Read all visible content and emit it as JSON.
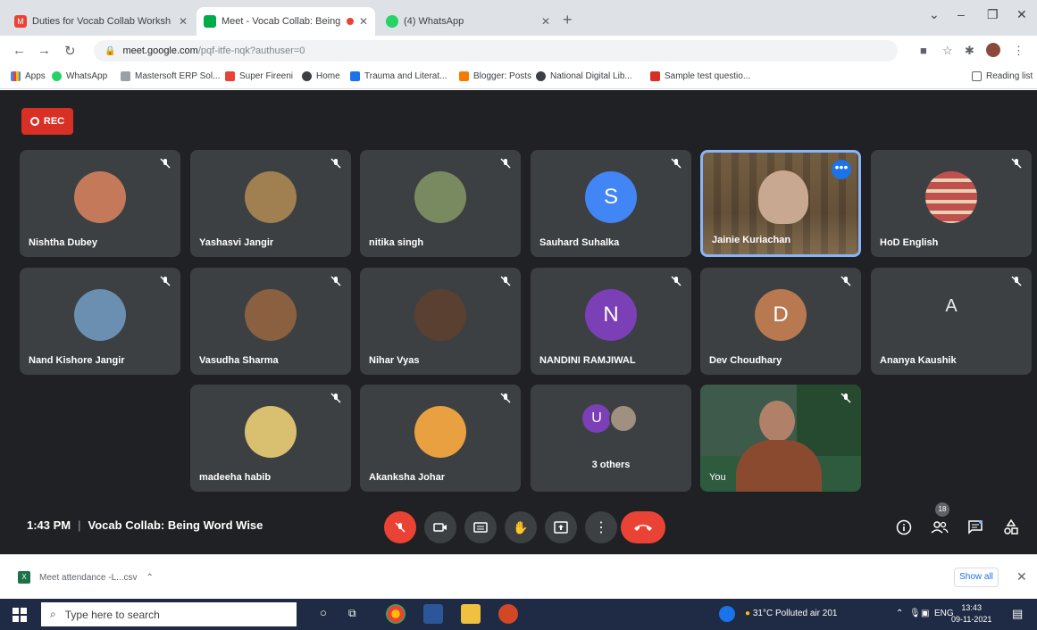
{
  "browser": {
    "tabs": [
      {
        "title": "Duties for Vocab Collab Worksh",
        "fav_color": "#ea4335",
        "active": false
      },
      {
        "title": "Meet - Vocab Collab: Being",
        "fav_color": "#00ac47",
        "active": true
      },
      {
        "title": "(4) WhatsApp",
        "fav_color": "#25d366",
        "active": false
      }
    ],
    "url_host": "meet.google.com",
    "url_path": "/pqf-itfe-nqk?authuser=0",
    "bookmarks": [
      "Apps",
      "WhatsApp",
      "Mastersoft ERP Sol...",
      "Super Fireeni",
      "Home",
      "Trauma and Literat...",
      "Blogger: Posts",
      "National Digital Lib...",
      "Sample test questio..."
    ],
    "reading_list": "Reading list"
  },
  "meet": {
    "rec_label": "REC",
    "participants": [
      {
        "name": "Nishtha Dubey",
        "avatar_bg": "#c47a5a"
      },
      {
        "name": "Yashasvi Jangir",
        "avatar_bg": "#a08050"
      },
      {
        "name": "nitika singh",
        "avatar_bg": "#7a8a60"
      },
      {
        "name": "Sauhard Suhalka",
        "initial": "S",
        "avatar_bg": "#4285f4"
      },
      {
        "name": "Jainie Kuriachan",
        "active": true
      },
      {
        "name": "HoD English",
        "avatar_bg": "#c0504d"
      },
      {
        "name": "Nand Kishore Jangir",
        "avatar_bg": "#6a8fb0"
      },
      {
        "name": "Vasudha Sharma",
        "avatar_bg": "#8a6040"
      },
      {
        "name": "Nihar Vyas",
        "avatar_bg": "#5a4030"
      },
      {
        "name": "NANDINI RAMJIWAL",
        "initial": "N",
        "avatar_bg": "#7b3fb6"
      },
      {
        "name": "Dev Choudhary",
        "initial": "D",
        "avatar_bg": "#b87850"
      },
      {
        "name": "Ananya Kaushik",
        "initial": "A"
      },
      {
        "name": "madeeha habib",
        "avatar_bg": "#d8c070"
      },
      {
        "name": "Akanksha Johar",
        "avatar_bg": "#e8a040"
      },
      {
        "name": "3 others",
        "initial": "U"
      },
      {
        "name": "You"
      }
    ],
    "time": "1:43 PM",
    "meeting_title": "Vocab Collab: Being Word Wise",
    "people_count": "18"
  },
  "downloads": {
    "file": "Meet attendance -L...csv",
    "show_all": "Show all"
  },
  "taskbar": {
    "search_placeholder": "Type here to search",
    "weather": "31°C  Polluted air 201",
    "lang": "ENG",
    "time": "13:43",
    "date": "09-11-2021"
  }
}
